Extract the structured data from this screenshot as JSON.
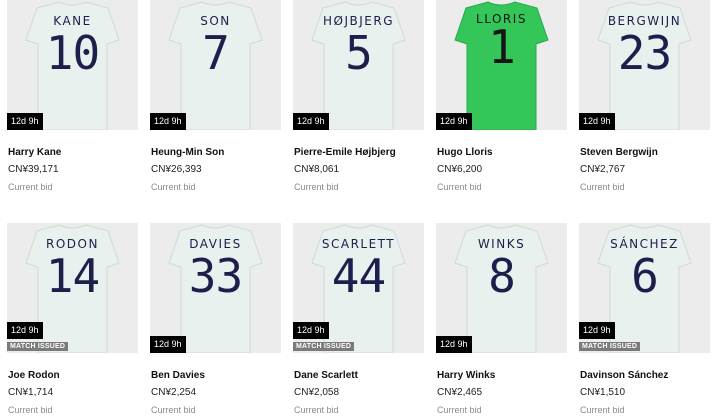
{
  "listings": [
    {
      "shirt_name": "KANE",
      "shirt_number": "10",
      "time_left": "12d 9h",
      "match_issued": "",
      "player": "Harry Kane",
      "price": "CN¥39,171",
      "bid_label": "Current bid",
      "shirt_color": "#e8f1ee"
    },
    {
      "shirt_name": "SON",
      "shirt_number": "7",
      "time_left": "12d 9h",
      "match_issued": "",
      "player": "Heung-Min Son",
      "price": "CN¥26,393",
      "bid_label": "Current bid",
      "shirt_color": "#e8f1ee"
    },
    {
      "shirt_name": "HØJBJERG",
      "shirt_number": "5",
      "time_left": "12d 9h",
      "match_issued": "",
      "player": "Pierre-Emile Højbjerg",
      "price": "CN¥8,061",
      "bid_label": "Current bid",
      "shirt_color": "#e8f1ee"
    },
    {
      "shirt_name": "LLORIS",
      "shirt_number": "1",
      "time_left": "12d 9h",
      "match_issued": "",
      "player": "Hugo Lloris",
      "price": "CN¥6,200",
      "bid_label": "Current bid",
      "shirt_color": "#35c65a"
    },
    {
      "shirt_name": "BERGWIJN",
      "shirt_number": "23",
      "time_left": "12d 9h",
      "match_issued": "",
      "player": "Steven Bergwijn",
      "price": "CN¥2,767",
      "bid_label": "Current bid",
      "shirt_color": "#e8f1ee"
    },
    {
      "shirt_name": "RODON",
      "shirt_number": "14",
      "time_left": "12d 9h",
      "match_issued": "MATCH ISSUED",
      "player": "Joe Rodon",
      "price": "CN¥1,714",
      "bid_label": "Current bid",
      "shirt_color": "#e8f1ee"
    },
    {
      "shirt_name": "DAVIES",
      "shirt_number": "33",
      "time_left": "12d 9h",
      "match_issued": "",
      "player": "Ben Davies",
      "price": "CN¥2,254",
      "bid_label": "Current bid",
      "shirt_color": "#e8f1ee"
    },
    {
      "shirt_name": "SCARLETT",
      "shirt_number": "44",
      "time_left": "12d 9h",
      "match_issued": "MATCH ISSUED",
      "player": "Dane Scarlett",
      "price": "CN¥2,058",
      "bid_label": "Current bid",
      "shirt_color": "#e8f1ee"
    },
    {
      "shirt_name": "WINKS",
      "shirt_number": "8",
      "time_left": "12d 9h",
      "match_issued": "",
      "player": "Harry Winks",
      "price": "CN¥2,465",
      "bid_label": "Current bid",
      "shirt_color": "#e8f1ee"
    },
    {
      "shirt_name": "SÁNCHEZ",
      "shirt_number": "6",
      "time_left": "12d 9h",
      "match_issued": "MATCH ISSUED",
      "player": "Davinson Sánchez",
      "price": "CN¥1,510",
      "bid_label": "Current bid",
      "shirt_color": "#e8f1ee"
    }
  ]
}
